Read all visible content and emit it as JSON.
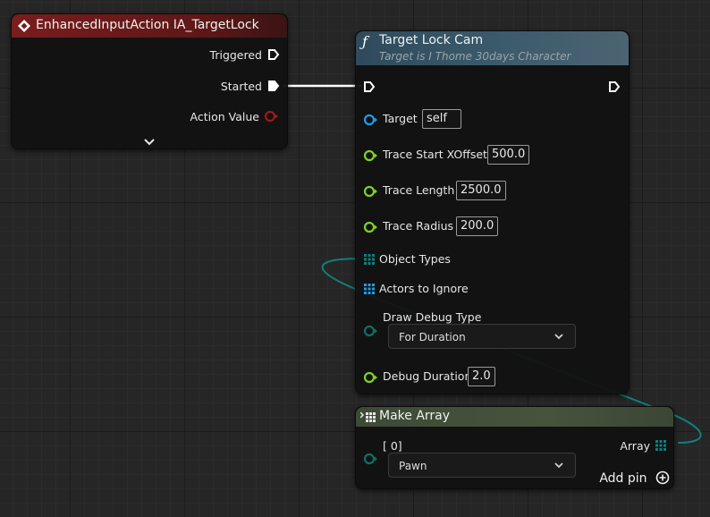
{
  "event_node": {
    "title": "EnhancedInputAction IA_TargetLock",
    "header_color": "#7a1d1d",
    "pins": {
      "triggered": "Triggered",
      "started": "Started",
      "action_value": "Action Value"
    },
    "expand_icon": "chevron-down-icon"
  },
  "function_node": {
    "icon_glyph": "ƒ",
    "title": "Target Lock Cam",
    "subtitle": "Target is I Thome 30days Character",
    "header_color": "#2e4a5c",
    "target": {
      "label": "Target",
      "value": "self"
    },
    "trace_start_xoffset": {
      "label": "Trace Start XOffset",
      "value": "500.0"
    },
    "trace_length": {
      "label": "Trace Length",
      "value": "2500.0"
    },
    "trace_radius": {
      "label": "Trace Radius",
      "value": "200.0"
    },
    "object_types": {
      "label": "Object Types"
    },
    "actors_to_ignore": {
      "label": "Actors to Ignore"
    },
    "draw_debug_type": {
      "label": "Draw Debug Type",
      "selected": "For Duration"
    },
    "debug_duration": {
      "label": "Debug Duration",
      "value": "2.0"
    }
  },
  "make_array_node": {
    "title": "Make Array",
    "header_color": "#3d4a36",
    "index_label": "[ 0]",
    "selected": "Pawn",
    "output_label": "Array",
    "add_pin_label": "Add pin"
  },
  "colors": {
    "exec_wire": "#ffffff",
    "object_pin": "#1f9ce8",
    "float_pin": "#7ed321",
    "enum_pin": "#0f6f60",
    "array_wire": "#127e7a",
    "action_value_pin": "#a01818"
  }
}
